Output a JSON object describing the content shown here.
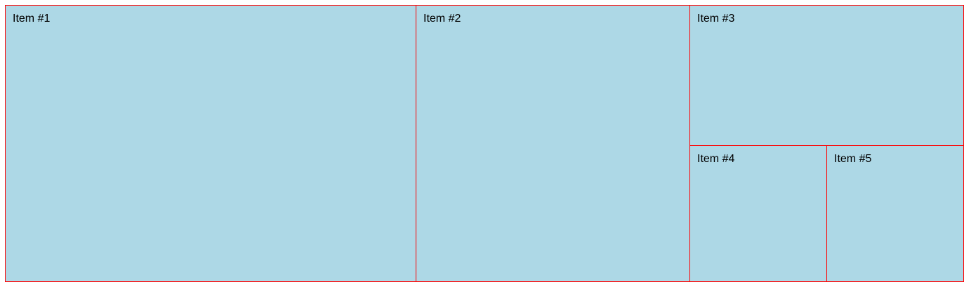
{
  "grid": {
    "items": [
      {
        "label": "Item #1"
      },
      {
        "label": "Item #2"
      },
      {
        "label": "Item #3"
      },
      {
        "label": "Item #4"
      },
      {
        "label": "Item #5"
      }
    ]
  },
  "colors": {
    "item_background": "#add8e6",
    "item_border": "#ff0000",
    "text": "#000000"
  }
}
